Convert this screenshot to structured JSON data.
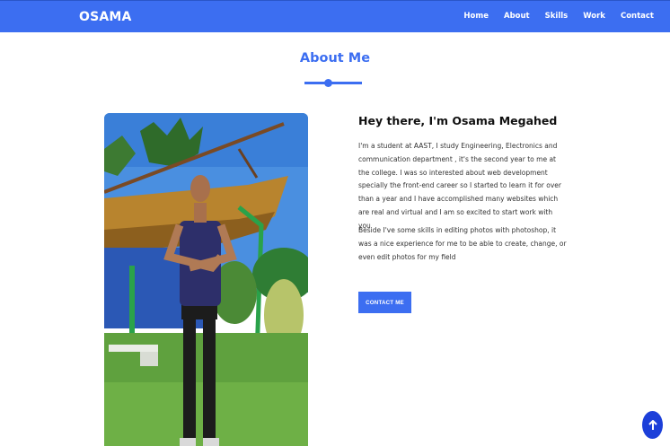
{
  "nav": {
    "brand": "OSAMA",
    "links": [
      "Home",
      "About",
      "Skills",
      "Work",
      "Contact"
    ]
  },
  "about": {
    "section_title": "About Me",
    "heading": "Hey there, I'm Osama Megahed",
    "paragraph1": "I'm a student at AAST, I study Engineering, Electronics and communication department , it's the second year to me at the college. I was so interested about web development specially the front-end career so I started to learn it for over than a year and I have accomplished many websites which are real and virtual and I am so excited to start work with you",
    "paragraph2": "Beside I've some skills in editing photos with photoshop, it was a nice experience for me to be able to create, change, or even edit photos for my field",
    "contact_button": "CONTACT ME"
  },
  "icons": {
    "scroll_top": "arrow-up-icon"
  },
  "colors": {
    "primary": "#3c6ef1",
    "scroll_button": "#1c3fd9"
  }
}
